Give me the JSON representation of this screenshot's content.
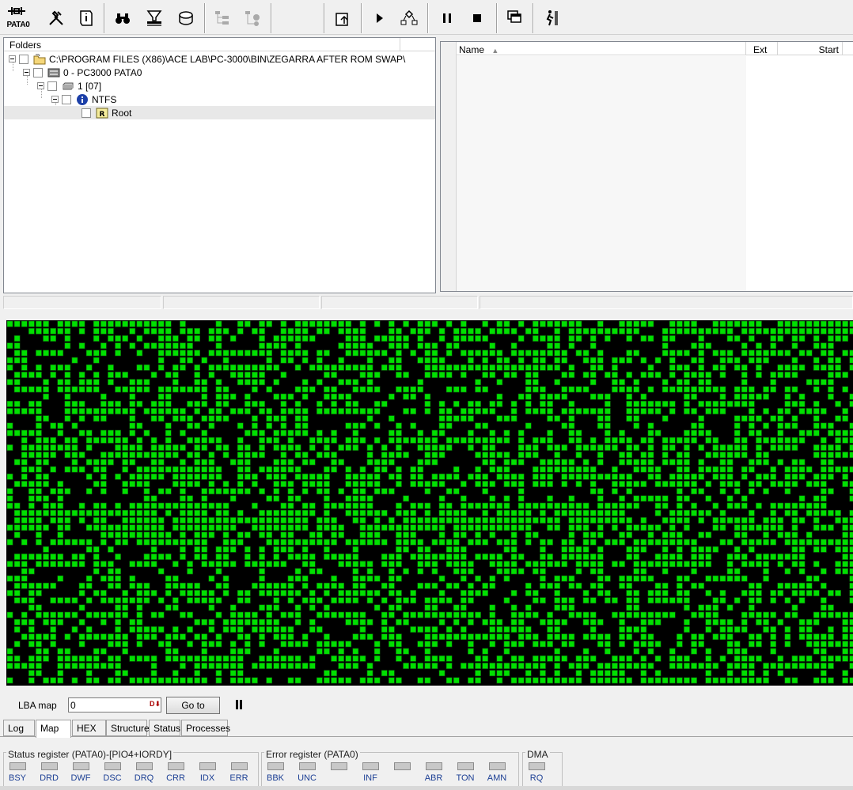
{
  "toolbar": {
    "device_label": "PATA0"
  },
  "folders": {
    "header": "Folders",
    "tree": [
      {
        "label": "C:\\PROGRAM FILES (X86)\\ACE LAB\\PC-3000\\BIN\\ZEGARRA AFTER ROM SWAP\\",
        "icon": "folder-icon"
      },
      {
        "label": "0 - PC3000 PATA0",
        "icon": "hard-drive-icon"
      },
      {
        "label": "1 [07]",
        "icon": "partition-icon"
      },
      {
        "label": "NTFS",
        "icon": "info-icon"
      },
      {
        "label": "Root",
        "icon": "root-folder-icon",
        "icon_text": "R"
      }
    ]
  },
  "files": {
    "columns": [
      "Name",
      "Ext",
      "Start"
    ]
  },
  "map": {
    "colors": {
      "good": "#00e000",
      "unread": "#000000",
      "border": "#0a3a0a"
    }
  },
  "lba": {
    "label": "LBA map",
    "value": "0",
    "input_icon": "D⬇",
    "goto_label": "Go to"
  },
  "tabs": [
    "Log",
    "Map",
    "HEX",
    "Structure",
    "Status",
    "Processes"
  ],
  "active_tab": "Map",
  "status_register": {
    "title": "Status register (PATA0)-[PIO4+IORDY]",
    "bits": [
      "BSY",
      "DRD",
      "DWF",
      "DSC",
      "DRQ",
      "CRR",
      "IDX",
      "ERR"
    ]
  },
  "error_register": {
    "title": "Error register (PATA0)",
    "bits": [
      "BBK",
      "UNC",
      "",
      "INF",
      "",
      "ABR",
      "TON",
      "AMN"
    ]
  },
  "dma": {
    "title": "DMA",
    "bits": [
      "RQ"
    ]
  }
}
